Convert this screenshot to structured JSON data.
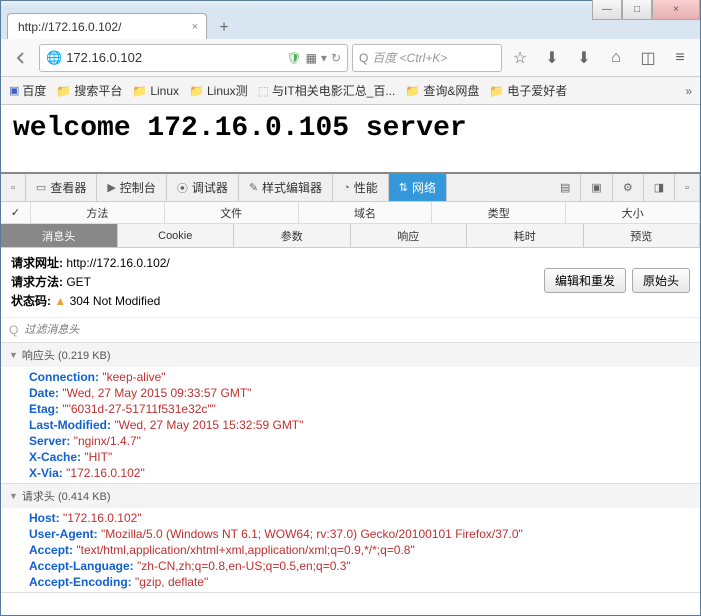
{
  "window": {
    "minimize": "—",
    "maximize": "□",
    "close": "×"
  },
  "tab": {
    "title": "http://172.16.0.102/",
    "plus": "+"
  },
  "url": "172.16.0.102",
  "search": {
    "placeholder": "百度 <Ctrl+K>"
  },
  "bookmarks": [
    "百度",
    "搜索平台",
    "Linux",
    "Linux测",
    "与IT相关电影汇总_百...",
    "查询&网盘",
    "电子爱好者"
  ],
  "page": {
    "heading": "welcome 172.16.0.105 server"
  },
  "devtabs": {
    "inspector": "查看器",
    "console": "控制台",
    "debugger": "调试器",
    "style": "样式编辑器",
    "perf": "性能",
    "network": "网络"
  },
  "netcols": {
    "method": "方法",
    "file": "文件",
    "domain": "域名",
    "type": "类型",
    "size": "大小"
  },
  "subtabs": {
    "headers": "消息头",
    "cookie": "Cookie",
    "params": "参数",
    "response": "响应",
    "timing": "耗时",
    "preview": "预览"
  },
  "request": {
    "url_label": "请求网址:",
    "url": "http://172.16.0.102/",
    "method_label": "请求方法:",
    "method": "GET",
    "status_label": "状态码:",
    "status": "304 Not Modified",
    "edit_resend": "编辑和重发",
    "raw": "原始头"
  },
  "filter": {
    "placeholder": "过滤消息头"
  },
  "response_section": {
    "title": "响应头 (0.219 KB)"
  },
  "response_headers": [
    {
      "k": "Connection:",
      "v": "\"keep-alive\""
    },
    {
      "k": "Date:",
      "v": "\"Wed, 27 May 2015 09:33:57 GMT\""
    },
    {
      "k": "Etag:",
      "v": "\"\"6031d-27-51711f531e32c\"\""
    },
    {
      "k": "Last-Modified:",
      "v": "\"Wed, 27 May 2015 15:32:59 GMT\""
    },
    {
      "k": "Server:",
      "v": "\"nginx/1.4.7\""
    },
    {
      "k": "X-Cache:",
      "v": "\"HIT\""
    },
    {
      "k": "X-Via:",
      "v": "\"172.16.0.102\""
    }
  ],
  "request_section": {
    "title": "请求头 (0.414 KB)"
  },
  "request_headers": [
    {
      "k": "Host:",
      "v": "\"172.16.0.102\""
    },
    {
      "k": "User-Agent:",
      "v": "\"Mozilla/5.0 (Windows NT 6.1; WOW64; rv:37.0) Gecko/20100101 Firefox/37.0\""
    },
    {
      "k": "Accept:",
      "v": "\"text/html,application/xhtml+xml,application/xml;q=0.9,*/*;q=0.8\""
    },
    {
      "k": "Accept-Language:",
      "v": "\"zh-CN,zh;q=0.8,en-US;q=0.5,en;q=0.3\""
    },
    {
      "k": "Accept-Encoding:",
      "v": "\"gzip, deflate\""
    }
  ]
}
